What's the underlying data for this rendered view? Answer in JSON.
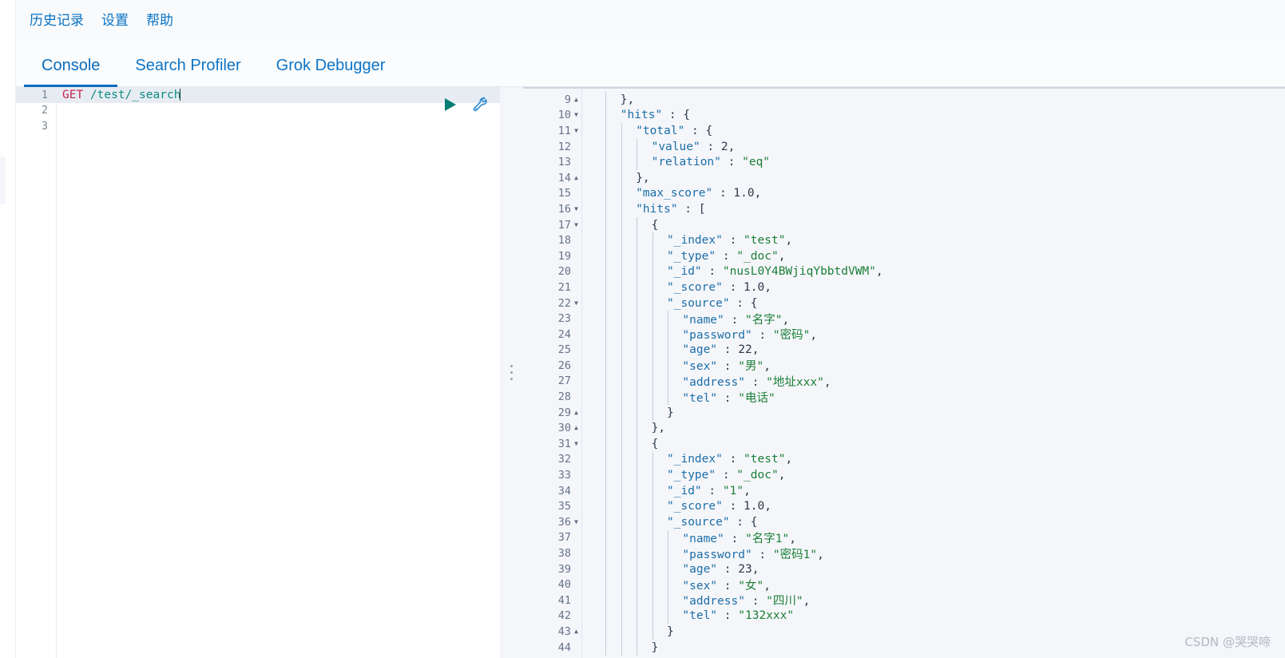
{
  "menubar": {
    "items": [
      {
        "label": "历史记录",
        "name": "menu-history"
      },
      {
        "label": "设置",
        "name": "menu-settings"
      },
      {
        "label": "帮助",
        "name": "menu-help"
      }
    ]
  },
  "tabs": [
    {
      "label": "Console",
      "active": true
    },
    {
      "label": "Search Profiler",
      "active": false
    },
    {
      "label": "Grok Debugger",
      "active": false
    }
  ],
  "editor": {
    "lines": [
      {
        "num": "1",
        "active": true,
        "method": "GET",
        "url": " /test/_search",
        "caret": true
      },
      {
        "num": "2",
        "active": false,
        "method": "",
        "url": "",
        "caret": false
      },
      {
        "num": "3",
        "active": false,
        "method": "",
        "url": "",
        "caret": false
      }
    ],
    "actions": {
      "play": "play-request-icon",
      "wrench": "open-documentation-wrench-icon"
    }
  },
  "splitter": {
    "handle": "drag-handle-dots"
  },
  "response": {
    "lines": [
      {
        "num": "9",
        "fold": "up",
        "indent": 2,
        "text": "},"
      },
      {
        "num": "10",
        "fold": "down",
        "indent": 2,
        "text": "\"hits\" : {"
      },
      {
        "num": "11",
        "fold": "down",
        "indent": 3,
        "text": "\"total\" : {"
      },
      {
        "num": "12",
        "fold": "",
        "indent": 4,
        "text": "\"value\" : 2,"
      },
      {
        "num": "13",
        "fold": "",
        "indent": 4,
        "text": "\"relation\" : \"eq\""
      },
      {
        "num": "14",
        "fold": "up",
        "indent": 3,
        "text": "},"
      },
      {
        "num": "15",
        "fold": "",
        "indent": 3,
        "text": "\"max_score\" : 1.0,"
      },
      {
        "num": "16",
        "fold": "down",
        "indent": 3,
        "text": "\"hits\" : ["
      },
      {
        "num": "17",
        "fold": "down",
        "indent": 4,
        "text": "{"
      },
      {
        "num": "18",
        "fold": "",
        "indent": 5,
        "text": "\"_index\" : \"test\","
      },
      {
        "num": "19",
        "fold": "",
        "indent": 5,
        "text": "\"_type\" : \"_doc\","
      },
      {
        "num": "20",
        "fold": "",
        "indent": 5,
        "text": "\"_id\" : \"nusL0Y4BWjiqYbbtdVWM\","
      },
      {
        "num": "21",
        "fold": "",
        "indent": 5,
        "text": "\"_score\" : 1.0,"
      },
      {
        "num": "22",
        "fold": "down",
        "indent": 5,
        "text": "\"_source\" : {"
      },
      {
        "num": "23",
        "fold": "",
        "indent": 6,
        "text": "\"name\" : \"名字\","
      },
      {
        "num": "24",
        "fold": "",
        "indent": 6,
        "text": "\"password\" : \"密码\","
      },
      {
        "num": "25",
        "fold": "",
        "indent": 6,
        "text": "\"age\" : 22,"
      },
      {
        "num": "26",
        "fold": "",
        "indent": 6,
        "text": "\"sex\" : \"男\","
      },
      {
        "num": "27",
        "fold": "",
        "indent": 6,
        "text": "\"address\" : \"地址xxx\","
      },
      {
        "num": "28",
        "fold": "",
        "indent": 6,
        "text": "\"tel\" : \"电话\""
      },
      {
        "num": "29",
        "fold": "up",
        "indent": 5,
        "text": "}"
      },
      {
        "num": "30",
        "fold": "up",
        "indent": 4,
        "text": "},"
      },
      {
        "num": "31",
        "fold": "down",
        "indent": 4,
        "text": "{"
      },
      {
        "num": "32",
        "fold": "",
        "indent": 5,
        "text": "\"_index\" : \"test\","
      },
      {
        "num": "33",
        "fold": "",
        "indent": 5,
        "text": "\"_type\" : \"_doc\","
      },
      {
        "num": "34",
        "fold": "",
        "indent": 5,
        "text": "\"_id\" : \"1\","
      },
      {
        "num": "35",
        "fold": "",
        "indent": 5,
        "text": "\"_score\" : 1.0,"
      },
      {
        "num": "36",
        "fold": "down",
        "indent": 5,
        "text": "\"_source\" : {"
      },
      {
        "num": "37",
        "fold": "",
        "indent": 6,
        "text": "\"name\" : \"名字1\","
      },
      {
        "num": "38",
        "fold": "",
        "indent": 6,
        "text": "\"password\" : \"密码1\","
      },
      {
        "num": "39",
        "fold": "",
        "indent": 6,
        "text": "\"age\" : 23,"
      },
      {
        "num": "40",
        "fold": "",
        "indent": 6,
        "text": "\"sex\" : \"女\","
      },
      {
        "num": "41",
        "fold": "",
        "indent": 6,
        "text": "\"address\" : \"四川\","
      },
      {
        "num": "42",
        "fold": "",
        "indent": 6,
        "text": "\"tel\" : \"132xxx\""
      },
      {
        "num": "43",
        "fold": "up",
        "indent": 5,
        "text": "}"
      },
      {
        "num": "44",
        "fold": "",
        "indent": 4,
        "text": "}"
      }
    ]
  },
  "watermark": {
    "text": "CSDN @哭哭啼"
  },
  "colors": {
    "accent": "#0a6bbd",
    "link": "#0a73c4",
    "method": "#c7254e",
    "url": "#0b8b82",
    "json_key": "#1b6ea8",
    "json_string": "#1a7f37",
    "play": "#017d73",
    "wrench": "#1a7fc4",
    "response_bg": "#f5f6fa"
  }
}
